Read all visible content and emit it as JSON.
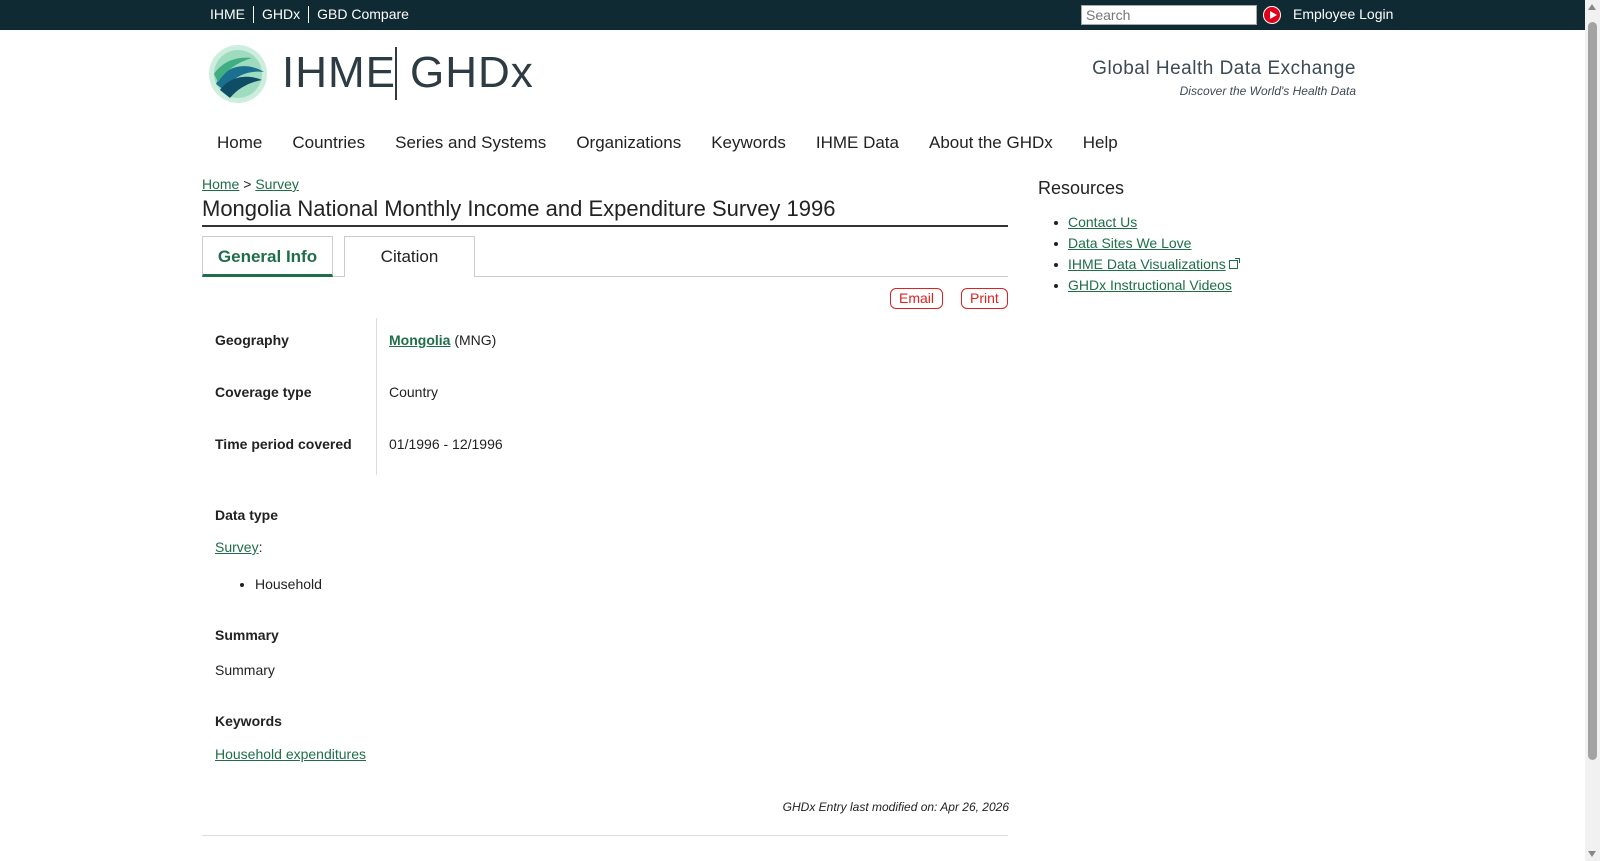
{
  "topbar": {
    "links": [
      "IHME",
      "GHDx",
      "GBD Compare"
    ],
    "search_placeholder": "Search",
    "employee_login": "Employee Login"
  },
  "header": {
    "logo_ihme": "IHME",
    "logo_ghdx": "GHDx",
    "tagline_title": "Global Health Data Exchange",
    "tagline_sub": "Discover the World's Health Data"
  },
  "nav": [
    "Home",
    "Countries",
    "Series and Systems",
    "Organizations",
    "Keywords",
    "IHME Data",
    "About the GHDx",
    "Help"
  ],
  "breadcrumb": {
    "home": "Home",
    "sep": ">",
    "survey": "Survey"
  },
  "page_title": "Mongolia National Monthly Income and Expenditure Survey 1996",
  "tabs": {
    "general": "General Info",
    "citation": "Citation"
  },
  "actions": {
    "email": "Email",
    "print": "Print"
  },
  "info": {
    "geography_label": "Geography",
    "geography_link": "Mongolia",
    "geography_code": "(MNG)",
    "coverage_label": "Coverage type",
    "coverage_value": "Country",
    "time_label": "Time period covered",
    "time_value": "01/1996 - 12/1996"
  },
  "data_type": {
    "label": "Data type",
    "link": "Survey",
    "suffix": ":",
    "item": "Household"
  },
  "summary": {
    "label": "Summary",
    "text": "Summary"
  },
  "keywords": {
    "label": "Keywords",
    "link": "Household expenditures"
  },
  "modified": "GHDx Entry last modified on: Apr 26, 2026",
  "sidebar": {
    "title": "Resources",
    "items": [
      "Contact Us",
      "Data Sites We Love",
      "IHME Data Visualizations",
      "GHDx Instructional Videos"
    ]
  },
  "colors": {
    "topbar": "#0f2a33",
    "link": "#1f6e4a",
    "accent_red": "#dd2222"
  }
}
